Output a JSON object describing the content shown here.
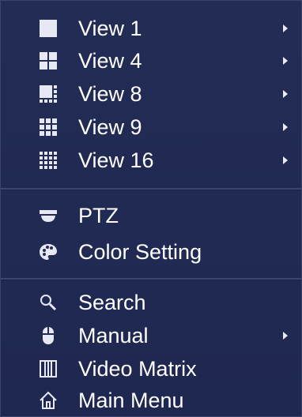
{
  "menu": {
    "items": [
      {
        "label": "View 1",
        "icon": "single-view-icon",
        "has_submenu": true
      },
      {
        "label": "View 4",
        "icon": "quad-view-icon",
        "has_submenu": true
      },
      {
        "label": "View 8",
        "icon": "eight-view-icon",
        "has_submenu": true
      },
      {
        "label": "View 9",
        "icon": "nine-view-icon",
        "has_submenu": true
      },
      {
        "label": "View 16",
        "icon": "sixteen-view-icon",
        "has_submenu": true
      },
      {
        "label": "PTZ",
        "icon": "ptz-camera-icon",
        "has_submenu": false
      },
      {
        "label": "Color Setting",
        "icon": "palette-icon",
        "has_submenu": false
      },
      {
        "label": "Search",
        "icon": "search-icon",
        "has_submenu": false
      },
      {
        "label": "Manual",
        "icon": "mouse-icon",
        "has_submenu": true
      },
      {
        "label": "Video Matrix",
        "icon": "video-matrix-icon",
        "has_submenu": false
      },
      {
        "label": "Main Menu",
        "icon": "home-icon",
        "has_submenu": false
      }
    ]
  },
  "colors": {
    "background": "#222b52",
    "text": "#ffffff",
    "separator": "#3b4673",
    "icon": "#e8ecf7"
  }
}
